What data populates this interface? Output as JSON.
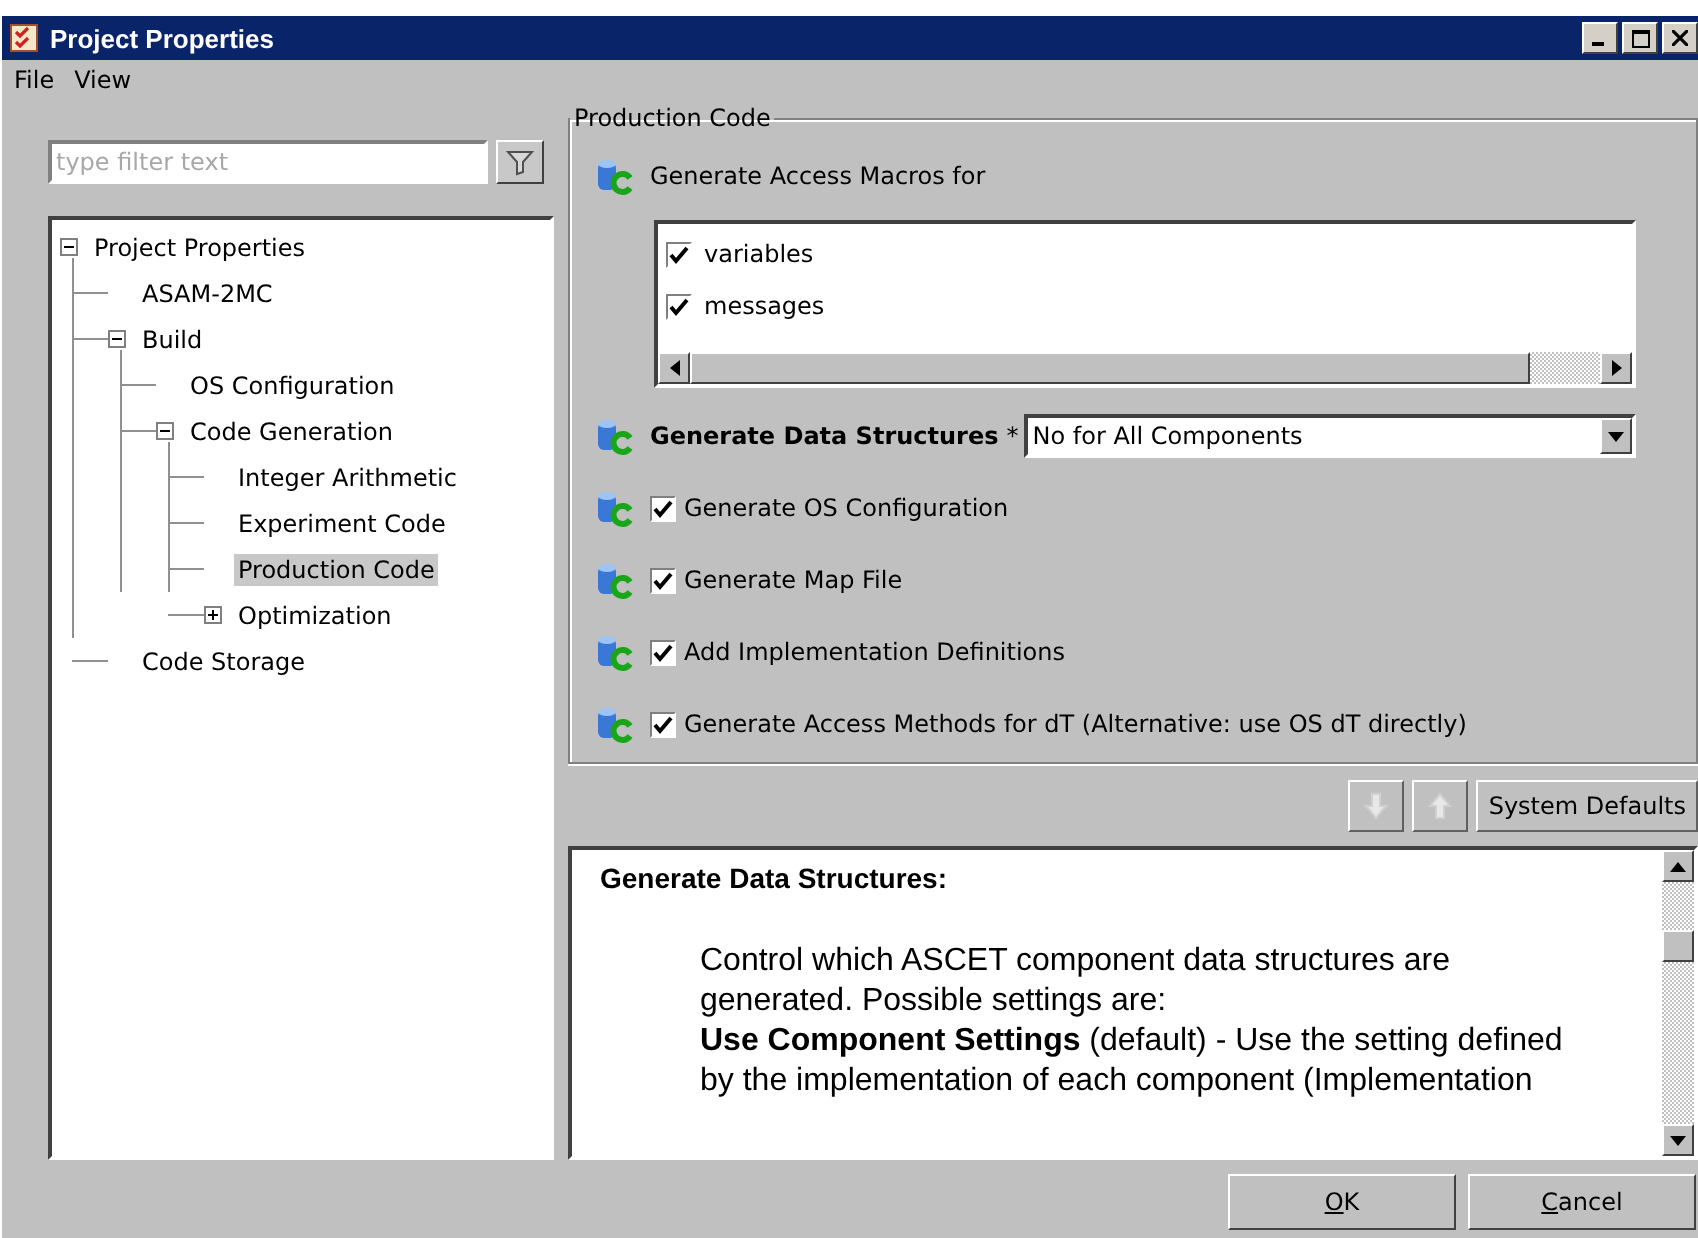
{
  "window": {
    "title": "Project Properties"
  },
  "menu": [
    "File",
    "View"
  ],
  "filter": {
    "placeholder": "type filter text"
  },
  "tree": [
    {
      "label": "Project Properties",
      "expanded": true,
      "selected": false,
      "children": [
        {
          "label": "ASAM-2MC",
          "selected": false
        },
        {
          "label": "Build",
          "expanded": true,
          "selected": false,
          "children": [
            {
              "label": "OS Configuration",
              "selected": false
            },
            {
              "label": "Code Generation",
              "expanded": true,
              "selected": false,
              "children": [
                {
                  "label": "Integer Arithmetic",
                  "selected": false
                },
                {
                  "label": "Experiment Code",
                  "selected": false
                },
                {
                  "label": "Production Code",
                  "selected": true
                },
                {
                  "label": "Optimization",
                  "expandable": true,
                  "expanded": false,
                  "selected": false
                }
              ]
            }
          ]
        },
        {
          "label": "Code Storage",
          "selected": false
        }
      ]
    }
  ],
  "group": {
    "title": "Production Code",
    "settings": [
      {
        "kind": "checklist",
        "label": "Generate Access Macros for",
        "options": [
          {
            "label": "variables",
            "checked": true
          },
          {
            "label": "messages",
            "checked": true
          }
        ]
      },
      {
        "kind": "dropdown",
        "label": "Generate Data Structures",
        "required_mark": "*",
        "value": "No for All Components"
      },
      {
        "kind": "checkbox",
        "label": "Generate OS Configuration",
        "checked": true
      },
      {
        "kind": "checkbox",
        "label": "Generate Map File",
        "checked": true
      },
      {
        "kind": "checkbox",
        "label": "Add Implementation Definitions",
        "checked": true
      },
      {
        "kind": "checkbox",
        "label": "Generate Access Methods for dT (Alternative: use OS dT directly)",
        "checked": true
      }
    ]
  },
  "toolbar": {
    "system_defaults": "System Defaults"
  },
  "help": {
    "title": "Generate Data Structures:",
    "paragraphs": [
      "Control which ASCET component data structures are generated. Possible settings are:",
      "**Use Component Settings** (default) - Use the setting defined by the implementation of each component (Implementation"
    ]
  },
  "buttons": [
    {
      "label": "OK"
    },
    {
      "label": "Cancel"
    }
  ]
}
